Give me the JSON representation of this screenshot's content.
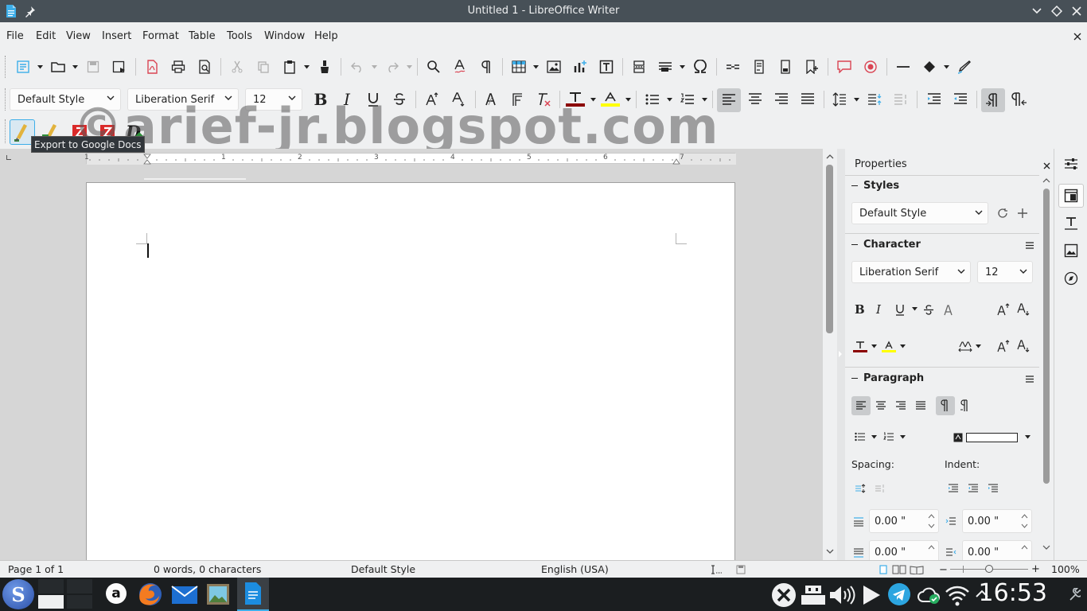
{
  "window": {
    "title": "Untitled 1 - LibreOffice Writer"
  },
  "menu": {
    "file": "File",
    "edit": "Edit",
    "view": "View",
    "insert": "Insert",
    "format": "Format",
    "table": "Table",
    "tools": "Tools",
    "window": "Window",
    "help": "Help"
  },
  "formatting": {
    "paragraph_style": "Default Style",
    "font_name": "Liberation Serif",
    "font_size": "12"
  },
  "watermark": "©arief-jr.blogspot.com",
  "tooltip": "Export to Google Docs",
  "ruler": {
    "numbers": [
      "1",
      "1",
      "2",
      "3",
      "4",
      "5",
      "6",
      "7"
    ]
  },
  "sidebar": {
    "title": "Properties",
    "styles_header": "Styles",
    "style_value": "Default Style",
    "character_header": "Character",
    "font_name": "Liberation Serif",
    "font_size": "12",
    "paragraph_header": "Paragraph",
    "spacing_label": "Spacing:",
    "indent_label": "Indent:",
    "above_spacing": "0.00 \"",
    "before_indent": "0.00 \"",
    "below_spacing": "0.00 \"",
    "after_indent": "0.00 \""
  },
  "status": {
    "page": "Page 1 of 1",
    "words": "0 words, 0 characters",
    "style": "Default Style",
    "language": "English (USA)",
    "zoom": "100%"
  },
  "taskbar": {
    "clock": "16:53"
  },
  "colors": {
    "titlebar": "#475057",
    "font_color": "#8b0000",
    "highlight": "#ffff00",
    "taskbar": "#1b1e20",
    "accent": "#3daee9"
  }
}
